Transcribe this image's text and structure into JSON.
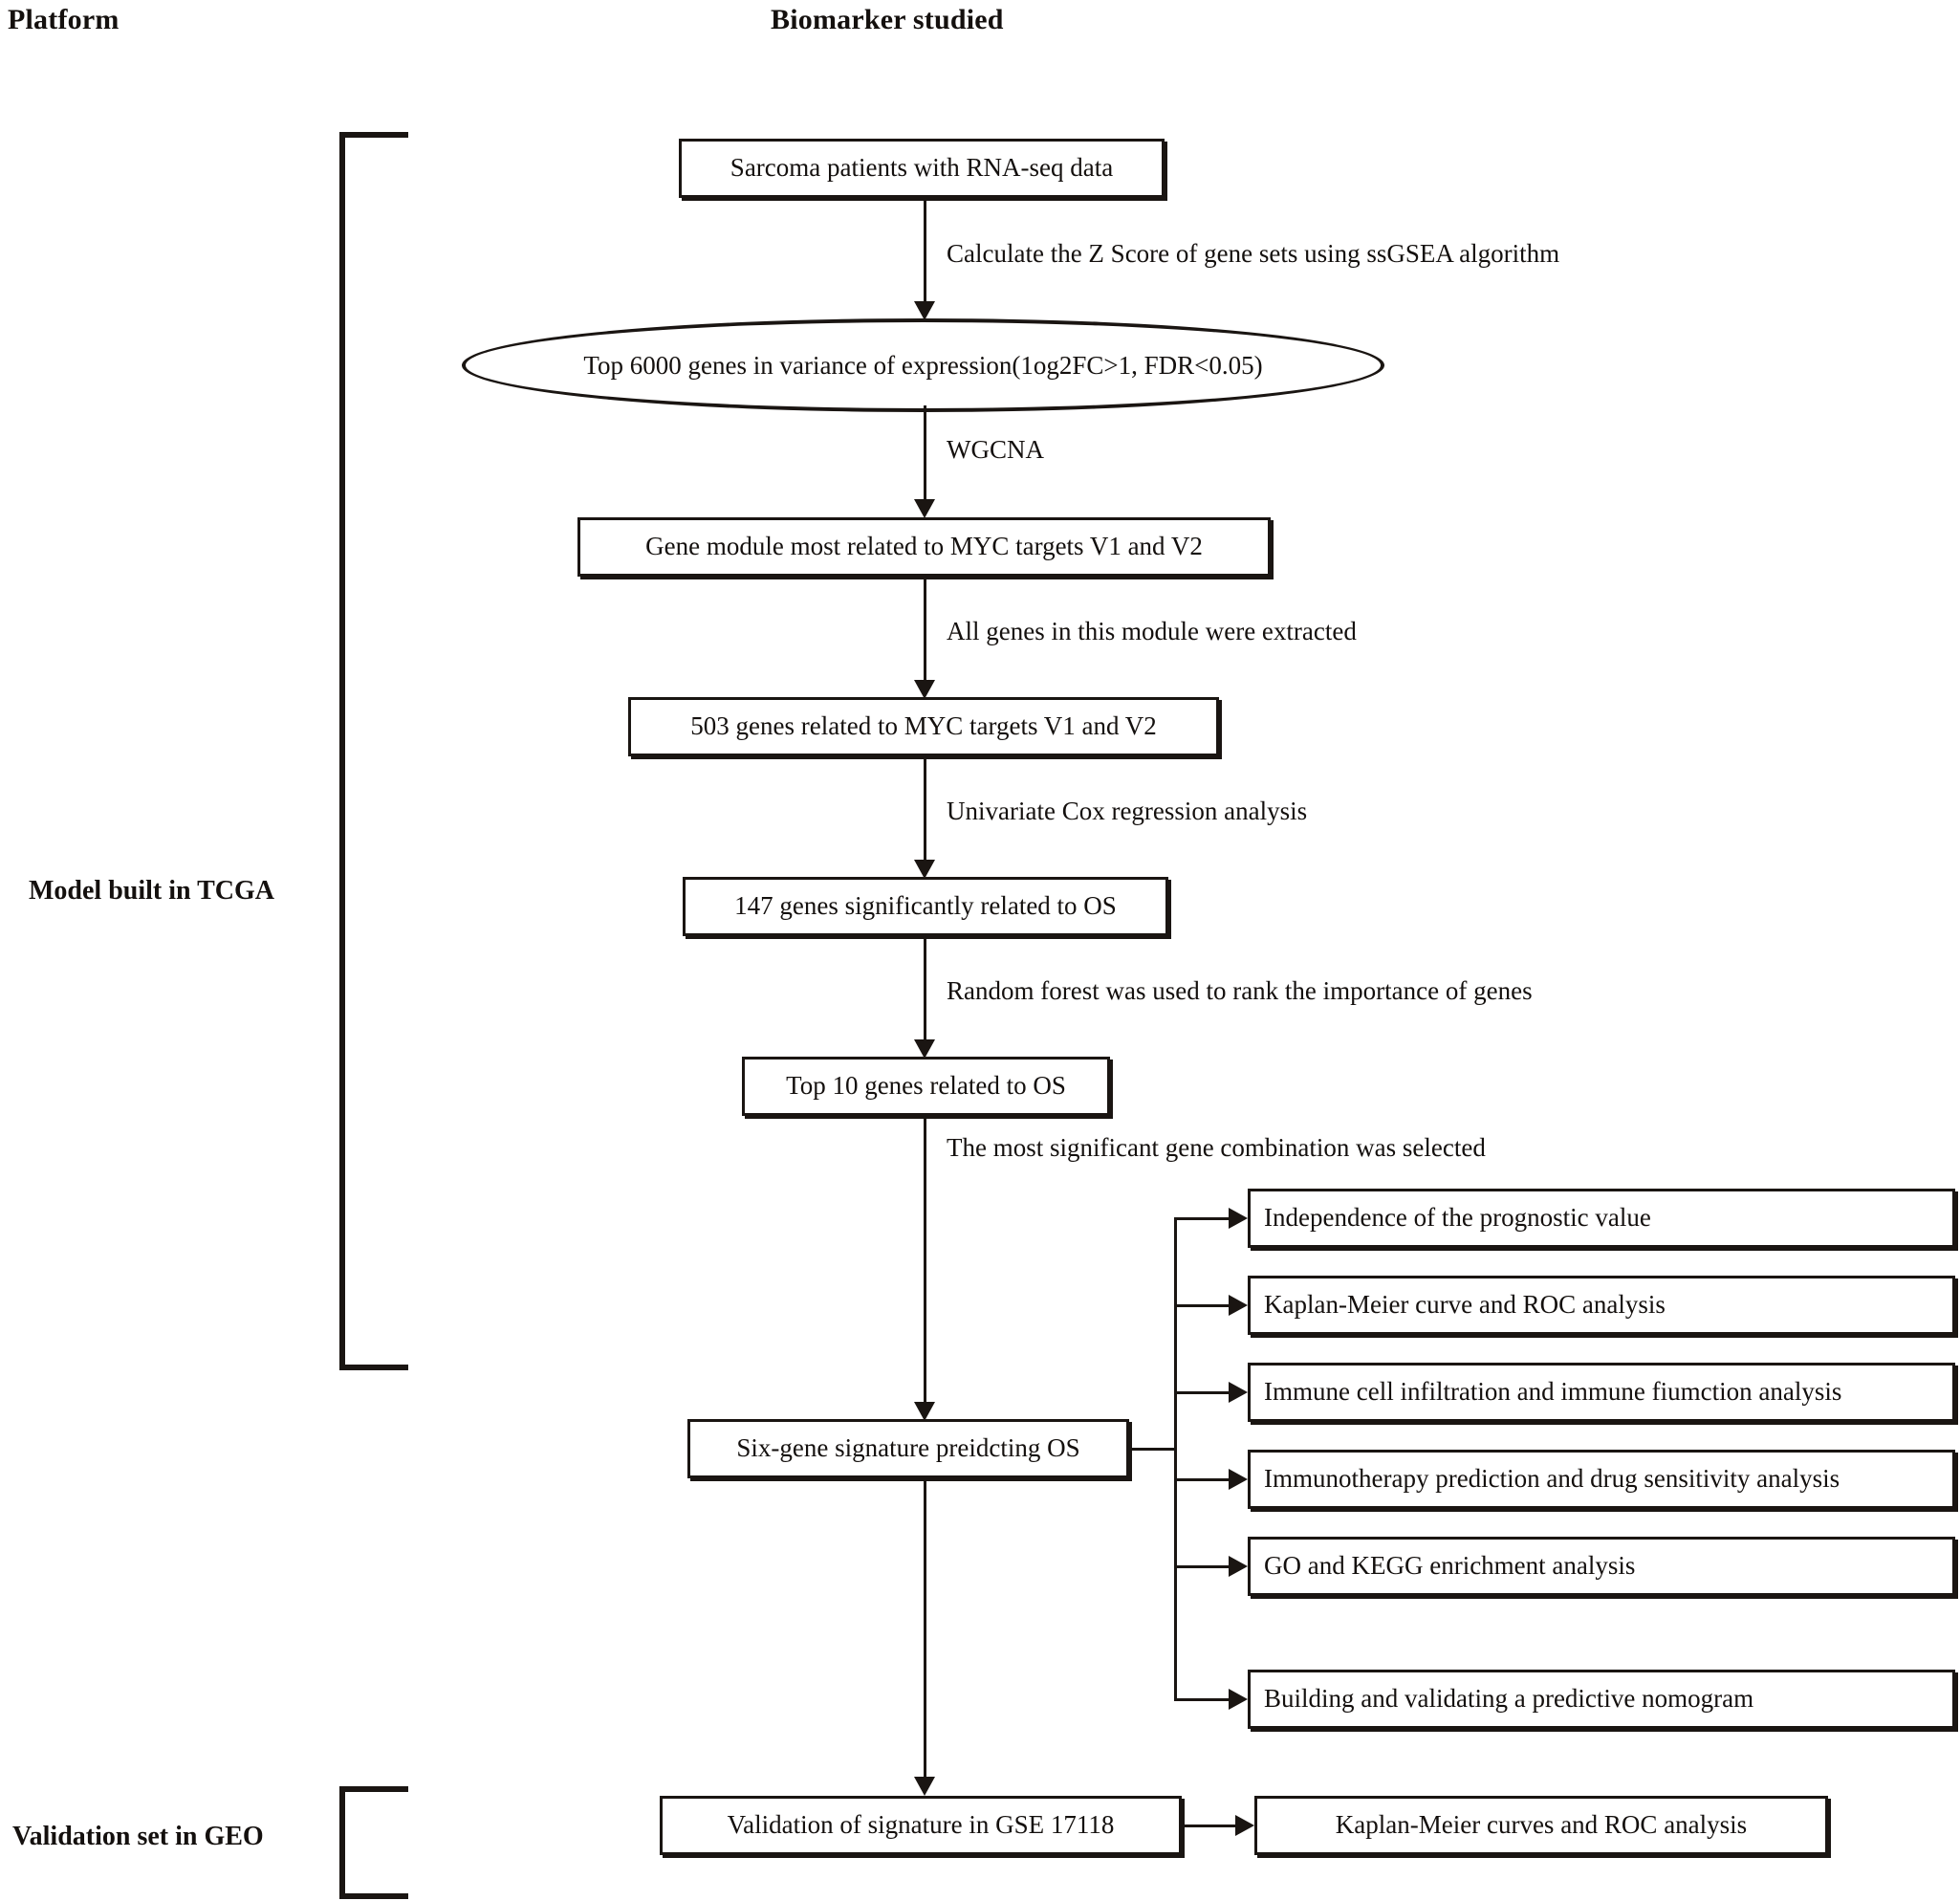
{
  "headers": {
    "platform": "Platform",
    "biomarker": "Biomarker studied"
  },
  "side_labels": {
    "tcga": "Model built in TCGA",
    "geo": "Validation set in GEO"
  },
  "main_flow": {
    "nodes": [
      {
        "id": "sarcoma",
        "label": "Sarcoma patients with RNA-seq data",
        "shape": "box"
      },
      {
        "id": "top6000",
        "label": "Top 6000 genes in variance of expression(1og2FC>1, FDR<0.05)",
        "shape": "ellipse"
      },
      {
        "id": "module",
        "label": "Gene module most related to MYC targets V1 and V2",
        "shape": "box"
      },
      {
        "id": "genes503",
        "label": "503 genes related to MYC targets V1 and V2",
        "shape": "box"
      },
      {
        "id": "genes147",
        "label": "147 genes significantly related to OS",
        "shape": "box"
      },
      {
        "id": "top10",
        "label": "Top 10 genes related to OS",
        "shape": "box"
      },
      {
        "id": "signature",
        "label": "Six-gene signature preidcting OS",
        "shape": "box"
      },
      {
        "id": "validation",
        "label": "Validation of signature in GSE 17118",
        "shape": "box"
      }
    ],
    "edge_labels": [
      {
        "id": "e1",
        "label": "Calculate the Z Score of gene sets using ssGSEA algorithm"
      },
      {
        "id": "e2",
        "label": "WGCNA"
      },
      {
        "id": "e3",
        "label": "All genes in this module were extracted"
      },
      {
        "id": "e4",
        "label": "Univariate Cox regression analysis"
      },
      {
        "id": "e5",
        "label": "Random forest was used to rank the importance of genes"
      },
      {
        "id": "e6",
        "label": "The most significant gene combination was selected"
      }
    ]
  },
  "analysis_branches": [
    {
      "id": "b1",
      "label": "Independence of the prognostic value"
    },
    {
      "id": "b2",
      "label": "Kaplan-Meier curve and ROC analysis"
    },
    {
      "id": "b3",
      "label": "Immune  cell infiltration and immune fiumction analysis"
    },
    {
      "id": "b4",
      "label": "Immunotherapy prediction and drug sensitivity analysis"
    },
    {
      "id": "b5",
      "label": "GO and KEGG enrichment analysis"
    },
    {
      "id": "b6",
      "label": "Building and validating a predictive nomogram"
    }
  ],
  "validation_branch": {
    "label": "Kaplan-Meier curves and ROC analysis"
  },
  "colors": {
    "ink": "#1a1512",
    "background": "#ffffff"
  }
}
